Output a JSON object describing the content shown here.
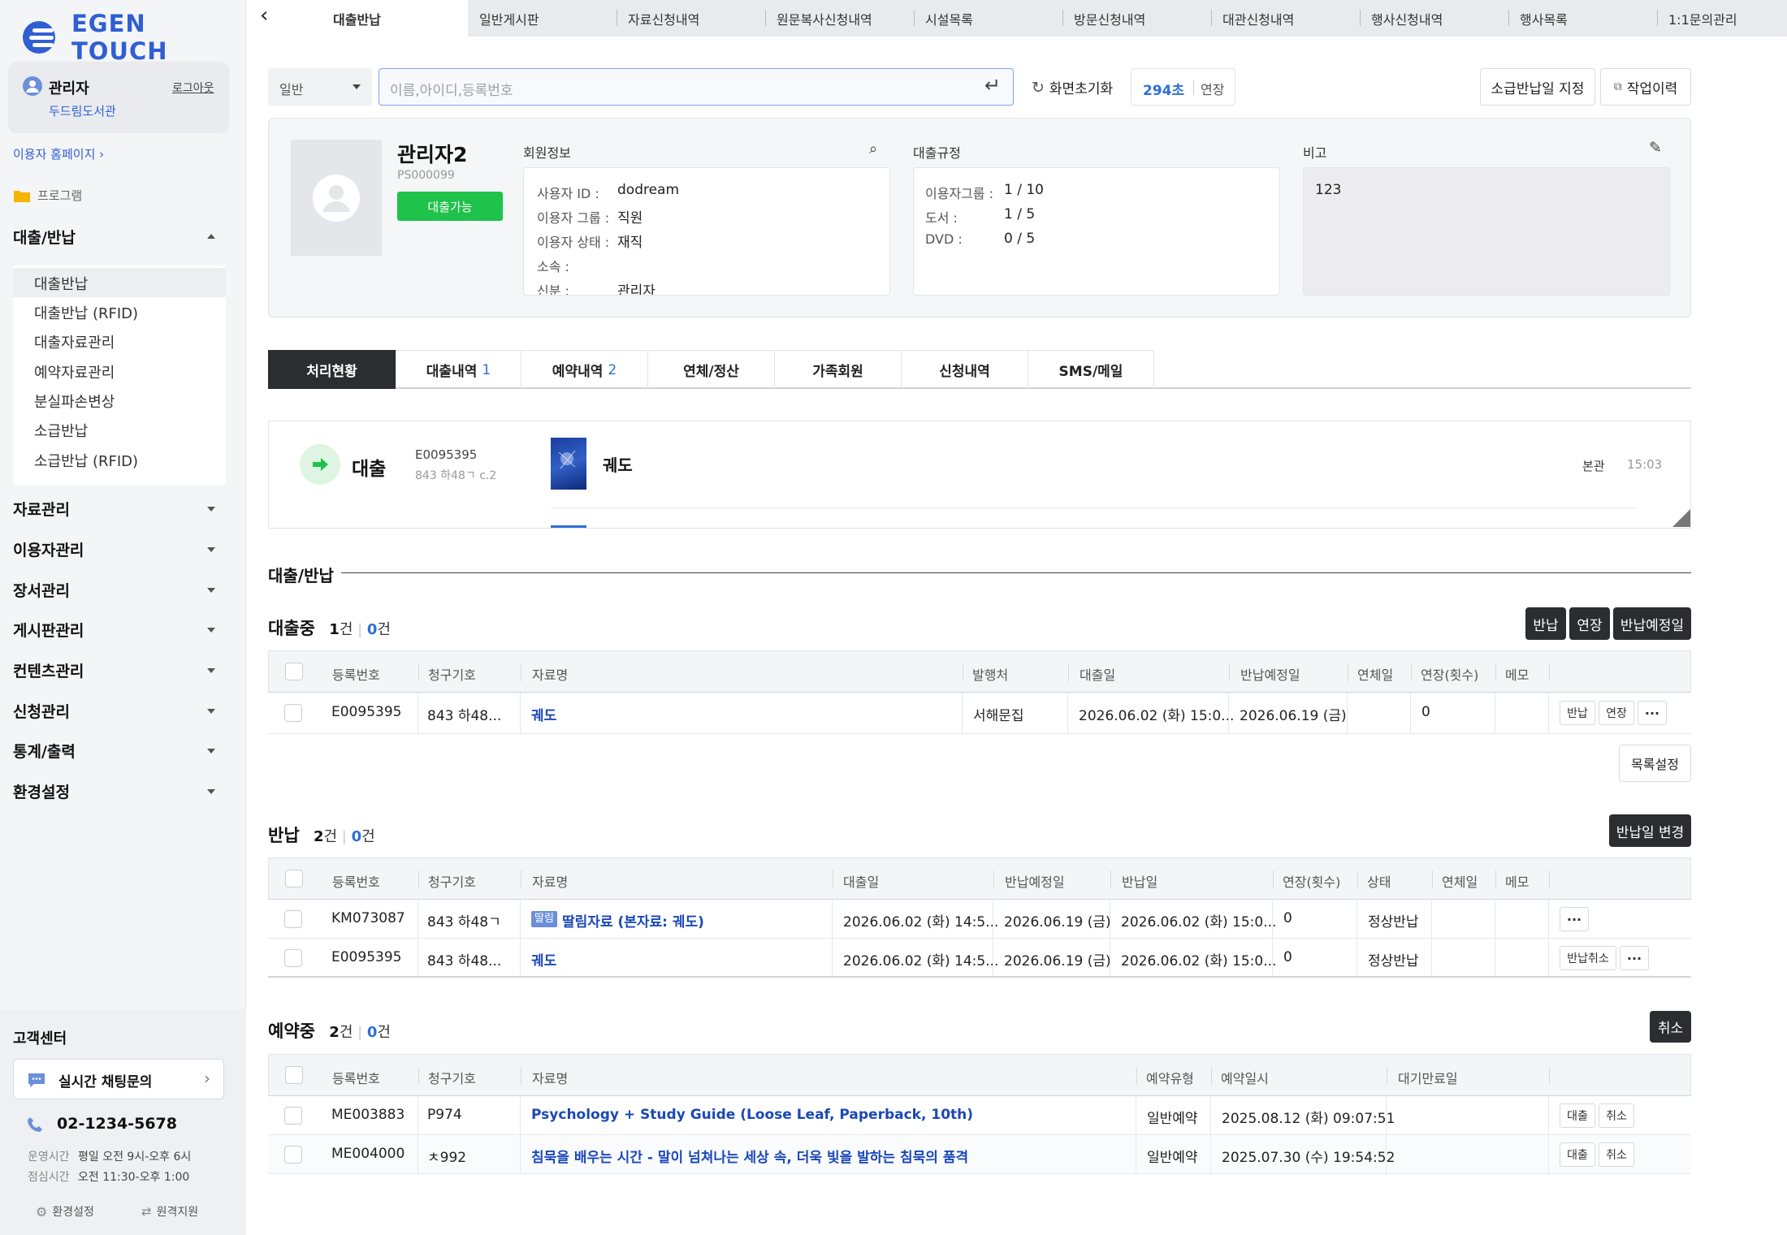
{
  "app": {
    "logo_text": "EGEN TOUCH"
  },
  "user": {
    "name": "관리자",
    "library": "두드림도서관",
    "logout": "로그아웃"
  },
  "sidebar": {
    "homepage_link": "이용자 홈페이지",
    "program_label": "프로그램",
    "menus": [
      {
        "label": "대출/반납",
        "expanded": true
      },
      {
        "label": "자료관리"
      },
      {
        "label": "이용자관리"
      },
      {
        "label": "장서관리"
      },
      {
        "label": "게시판관리"
      },
      {
        "label": "컨텐츠관리"
      },
      {
        "label": "신청관리"
      },
      {
        "label": "통계/출력"
      },
      {
        "label": "환경설정"
      }
    ],
    "submenu": [
      "대출반납",
      "대출반납 (RFID)",
      "대출자료관리",
      "예약자료관리",
      "분실파손변상",
      "소급반납",
      "소급반납 (RFID)"
    ],
    "support": {
      "title": "고객센터",
      "chat": "실시간 채팅문의",
      "phone": "02-1234-5678",
      "hours_label": "운영시간",
      "hours": "평일 오전 9시-오후 6시",
      "lunch_label": "점심시간",
      "lunch": "오전 11:30-오후 1:00",
      "settings": "환경설정",
      "remote": "원격지원"
    }
  },
  "top_tabs": [
    "대출반납",
    "일반게시판",
    "자료신청내역",
    "원문복사신청내역",
    "시설목록",
    "방문신청내역",
    "대관신청내역",
    "행사신청내역",
    "행사목록",
    "1:1문의관리"
  ],
  "search": {
    "type": "일반",
    "placeholder": "이름,아이디,등록번호",
    "reset": "화면초기화",
    "timer": "294초",
    "extend": "연장",
    "retro_date": "소급반납일 지정",
    "history": "작업이력"
  },
  "member": {
    "name": "관리자2",
    "id_code": "PS000099",
    "status_badge": "대출가능",
    "info_title": "회원정보",
    "fields": [
      {
        "label": "사용자 ID :",
        "value": "dodream"
      },
      {
        "label": "이용자 그룹 :",
        "value": "직원"
      },
      {
        "label": "이용자 상태 :",
        "value": "재직"
      },
      {
        "label": "소속 :",
        "value": ""
      },
      {
        "label": "신분 :",
        "value": "관리자"
      }
    ],
    "rules_title": "대출규정",
    "rules": [
      {
        "label": "이용자그룹 :",
        "value": "1 / 10"
      },
      {
        "label": "도서 :",
        "value": "1 / 5"
      },
      {
        "label": "DVD :",
        "value": "0 / 5"
      }
    ],
    "note_title": "비고",
    "note": "123"
  },
  "process_tabs": [
    {
      "label": "처리현황",
      "count": ""
    },
    {
      "label": "대출내역",
      "count": "1"
    },
    {
      "label": "예약내역",
      "count": "2"
    },
    {
      "label": "연체/정산",
      "count": ""
    },
    {
      "label": "가족회원",
      "count": ""
    },
    {
      "label": "신청내역",
      "count": ""
    },
    {
      "label": "SMS/메일",
      "count": ""
    }
  ],
  "process_item": {
    "action": "대출",
    "reg_no": "E0095395",
    "call_no": "843 하48ㄱ c.2",
    "title": "궤도",
    "branch": "본관",
    "time": "15:03"
  },
  "section_title": "대출/반납",
  "loans": {
    "title": "대출중",
    "count": "1",
    "count_unit": "건",
    "count2": "0",
    "buttons": [
      "반납",
      "연장",
      "반납예정일"
    ],
    "headers": [
      "등록번호",
      "청구기호",
      "자료명",
      "발행처",
      "대출일",
      "반납예정일",
      "연체일",
      "연장(횟수)",
      "메모"
    ],
    "rows": [
      {
        "reg": "E0095395",
        "call": "843 하48...",
        "title": "궤도",
        "pub": "서해문집",
        "loan": "2026.06.02 (화) 15:0...",
        "due": "2026.06.19 (금)",
        "overdue": "",
        "ext": "0",
        "memo": "",
        "btn1": "반납",
        "btn2": "연장"
      }
    ],
    "list_settings": "목록설정"
  },
  "returns": {
    "title": "반납",
    "count": "2",
    "count_unit": "건",
    "count2": "0",
    "button": "반납일 변경",
    "headers": [
      "등록번호",
      "청구기호",
      "자료명",
      "대출일",
      "반납예정일",
      "반납일",
      "연장(횟수)",
      "상태",
      "연체일",
      "메모"
    ],
    "rows": [
      {
        "reg": "KM073087",
        "call": "843 하48ㄱ",
        "tag": "딸림",
        "title": "딸림자료 (본자료: 궤도)",
        "loan": "2026.06.02 (화) 14:5...",
        "due": "2026.06.19 (금)",
        "ret": "2026.06.02 (화) 15:0...",
        "ext": "0",
        "status": "정상반납",
        "btn": ""
      },
      {
        "reg": "E0095395",
        "call": "843 하48...",
        "tag": "",
        "title": "궤도",
        "loan": "2026.06.02 (화) 14:5...",
        "due": "2026.06.19 (금)",
        "ret": "2026.06.02 (화) 15:0...",
        "ext": "0",
        "status": "정상반납",
        "btn": "반납취소"
      }
    ]
  },
  "reservations": {
    "title": "예약중",
    "count": "2",
    "count_unit": "건",
    "count2": "0",
    "button": "취소",
    "headers": [
      "등록번호",
      "청구기호",
      "자료명",
      "예약유형",
      "예약일시",
      "대기만료일"
    ],
    "rows": [
      {
        "reg": "ME003883",
        "call": "P974",
        "title": "Psychology + Study Guide (Loose Leaf, Paperback, 10th)",
        "type": "일반예약",
        "date": "2025.08.12 (화) 09:07:51",
        "expire": "",
        "btn1": "대출",
        "btn2": "취소"
      },
      {
        "reg": "ME004000",
        "call": "ㅊ992",
        "title": "침묵을 배우는 시간 - 말이 넘쳐나는 세상 속, 더욱 빛을 발하는 침묵의 품격",
        "type": "일반예약",
        "date": "2025.07.30 (수) 19:54:52",
        "expire": "",
        "btn1": "대출",
        "btn2": "취소"
      }
    ]
  },
  "colors": {
    "accent": "#2f6fd6",
    "brand": "#2f5fd2",
    "badge_green": "#1fc24a",
    "dark_button": "#2b2d31",
    "link": "#1b48b8"
  }
}
